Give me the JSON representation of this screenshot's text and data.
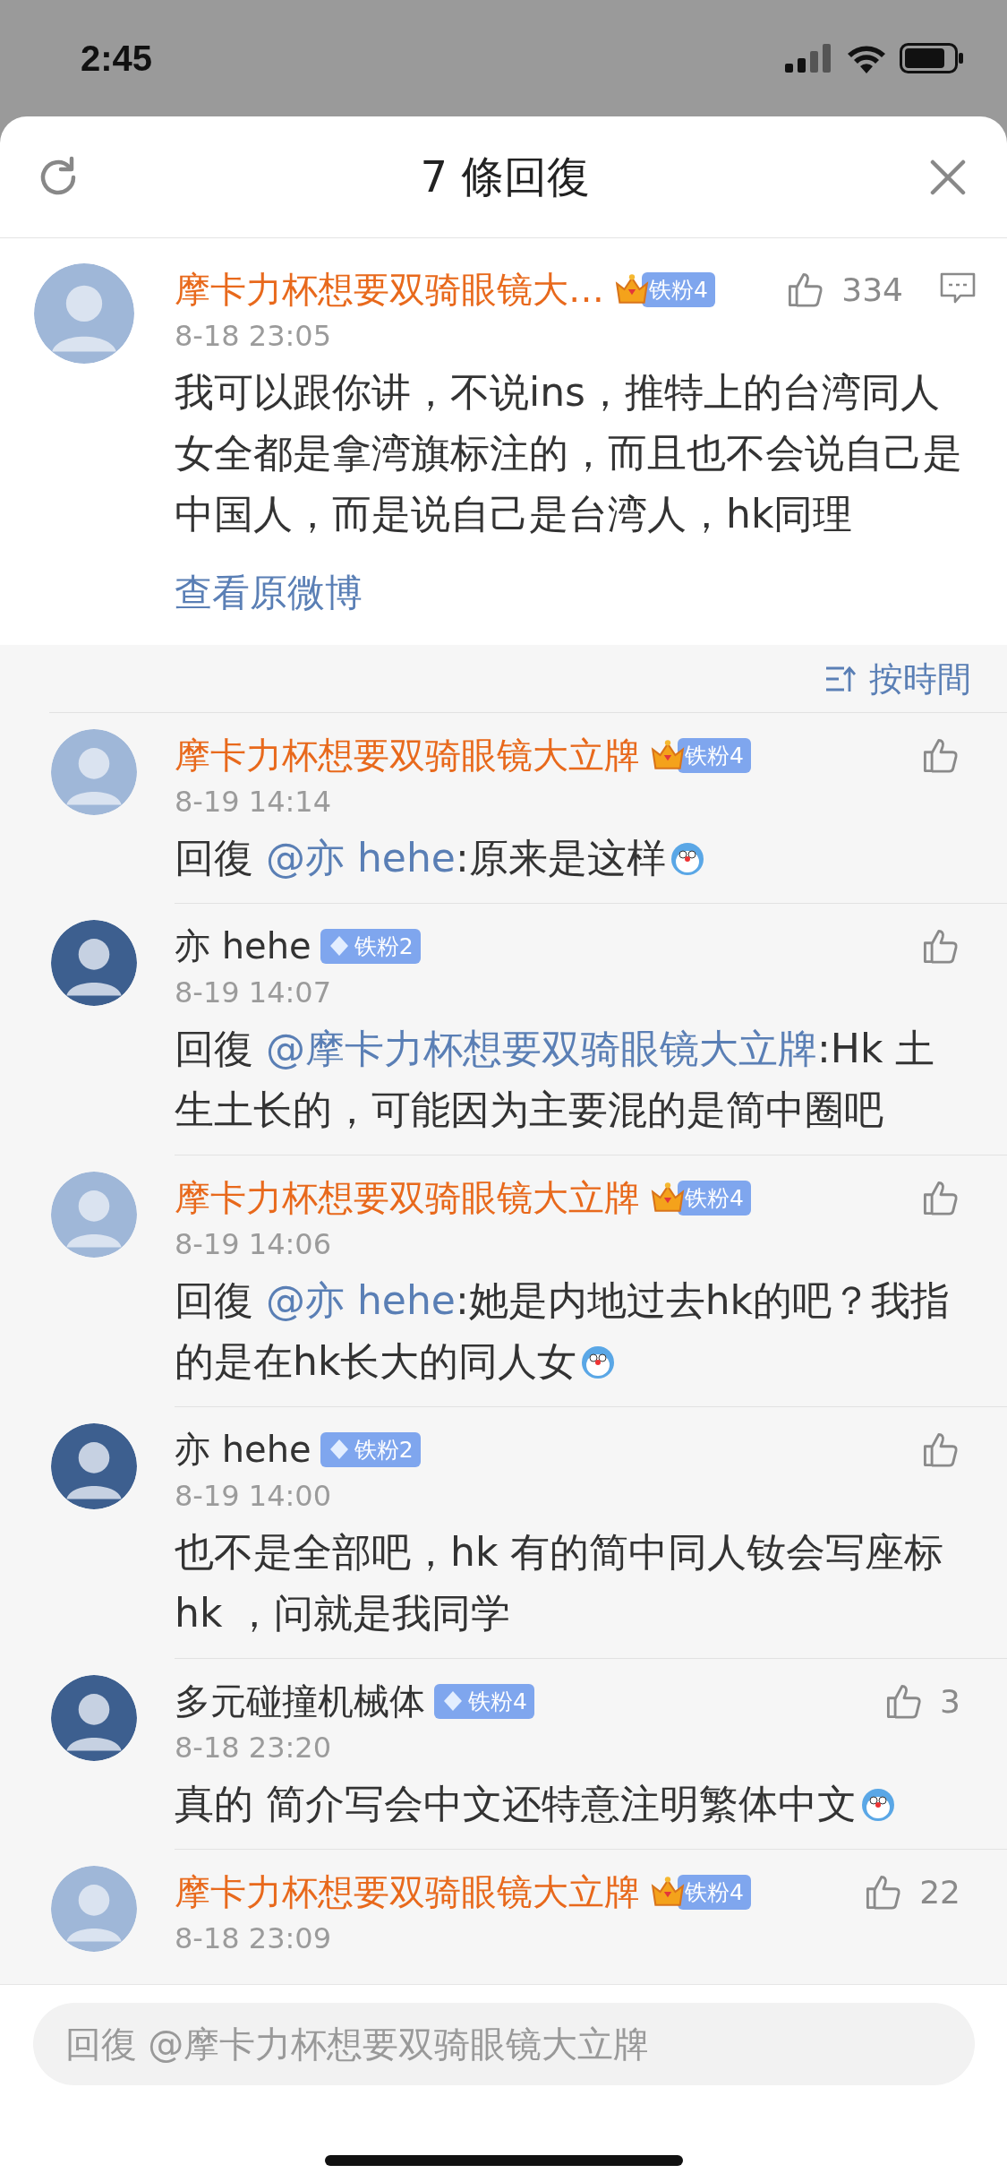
{
  "status_bar": {
    "time": "2:45"
  },
  "header": {
    "title": "7 條回復"
  },
  "main_comment": {
    "name": "摩卡力杯想要双骑眼镜大…",
    "vip": true,
    "badge": {
      "kind": "crown",
      "label": "铁粉4"
    },
    "time": "8-18 23:05",
    "likes": "334",
    "body": [
      {
        "text": "我可以跟你讲，不说ins，推特上的台湾同人女全都是拿湾旗标注的，而且也不会说自己是中国人，而是说自己是台湾人，hk同理"
      }
    ],
    "link": "查看原微博"
  },
  "sort": {
    "label": "按時間"
  },
  "replies": [
    {
      "name": "摩卡力杯想要双骑眼镜大立牌",
      "vip": true,
      "badge": {
        "kind": "crown",
        "label": "铁粉4"
      },
      "time": "8-19 14:14",
      "body": [
        {
          "text": "回復 "
        },
        {
          "mention": "@亦 hehe"
        },
        {
          "text": ":原来是这样"
        }
      ],
      "emoji": true
    },
    {
      "name": "亦 hehe",
      "vip": false,
      "badge": {
        "kind": "diamond",
        "label": "铁粉2"
      },
      "time": "8-19 14:07",
      "body": [
        {
          "text": "回復 "
        },
        {
          "mention": "@摩卡力杯想要双骑眼镜大立牌"
        },
        {
          "text": ":Hk 土生土长的，可能因为主要混的是简中圈吧"
        }
      ]
    },
    {
      "name": "摩卡力杯想要双骑眼镜大立牌",
      "vip": true,
      "badge": {
        "kind": "crown",
        "label": "铁粉4"
      },
      "time": "8-19 14:06",
      "body": [
        {
          "text": "回復 "
        },
        {
          "mention": "@亦 hehe"
        },
        {
          "text": ":她是内地过去hk的吧？我指的是在hk长大的同人女"
        }
      ],
      "emoji": true
    },
    {
      "name": "亦 hehe",
      "vip": false,
      "badge": {
        "kind": "diamond",
        "label": "铁粉2"
      },
      "time": "8-19 14:00",
      "body": [
        {
          "text": "也不是全部吧，hk 有的简中同人钕会写座标hk ，问就是我同学"
        }
      ]
    },
    {
      "name": "多元碰撞机械体",
      "vip": false,
      "badge": {
        "kind": "diamond",
        "label": "铁粉4"
      },
      "time": "8-18 23:20",
      "likes": "3",
      "body": [
        {
          "text": "真的  简介写会中文还特意注明繁体中文"
        }
      ],
      "emoji": true
    },
    {
      "name": "摩卡力杯想要双骑眼镜大立牌",
      "vip": true,
      "badge": {
        "kind": "crown",
        "label": "铁粉4"
      },
      "time": "8-18 23:09",
      "likes": "22"
    }
  ],
  "reply_field": {
    "placeholder": "回復 @摩卡力杯想要双骑眼镜大立牌"
  }
}
